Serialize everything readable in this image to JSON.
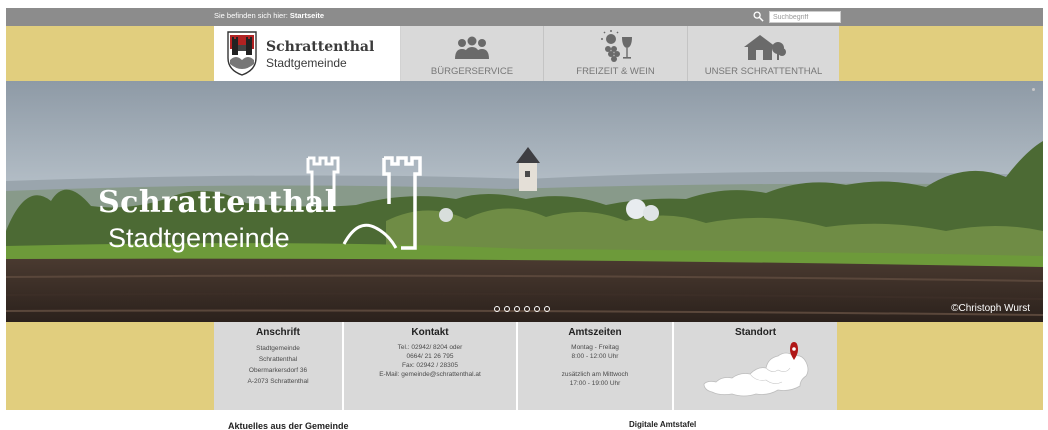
{
  "topbar": {
    "breadcrumb_prefix": "Sie befinden sich hier:",
    "breadcrumb_current": "Startseite",
    "search_placeholder": "Suchbegriff"
  },
  "header": {
    "logo_title": "Schrattenthal",
    "logo_subtitle": "Stadtgemeinde",
    "nav": [
      {
        "label": "BÜRGERSERVICE",
        "icon": "people-icon"
      },
      {
        "label": "FREIZEIT & WEIN",
        "icon": "leisure-wine-icon"
      },
      {
        "label": "UNSER SCHRATTENTHAL",
        "icon": "house-tree-icon"
      }
    ]
  },
  "hero": {
    "logo_title": "Schrattenthal",
    "logo_subtitle": "Stadtgemeinde",
    "credit": "©Christoph Wurst",
    "slide_count": 6
  },
  "info": {
    "address": {
      "title": "Anschrift",
      "lines": [
        "Stadtgemeinde",
        "Schrattenthal",
        "Obermarkersdorf 36",
        "A-2073 Schrattenthal"
      ]
    },
    "contact": {
      "title": "Kontakt",
      "lines": [
        "Tel.: 02942/ 8204 oder",
        "0664/ 21 26 795",
        "Fax: 02942 / 28305",
        "E-Mail: gemeinde@schrattenthal.at"
      ]
    },
    "hours": {
      "title": "Amtszeiten",
      "lines": [
        "Montag - Freitag",
        "8:00 - 12:00 Uhr",
        "zusätzlich am Mittwoch",
        "17:00 - 19:00 Uhr"
      ]
    },
    "location": {
      "title": "Standort"
    }
  },
  "content": {
    "news_title": "Aktuelles aus der Gemeinde",
    "board_title": "Digitale Amtstafel"
  },
  "colors": {
    "gold": "#e1ce7e",
    "topbar": "#8c8c8c",
    "tile": "#d9d9d9",
    "pin": "#b01717"
  }
}
